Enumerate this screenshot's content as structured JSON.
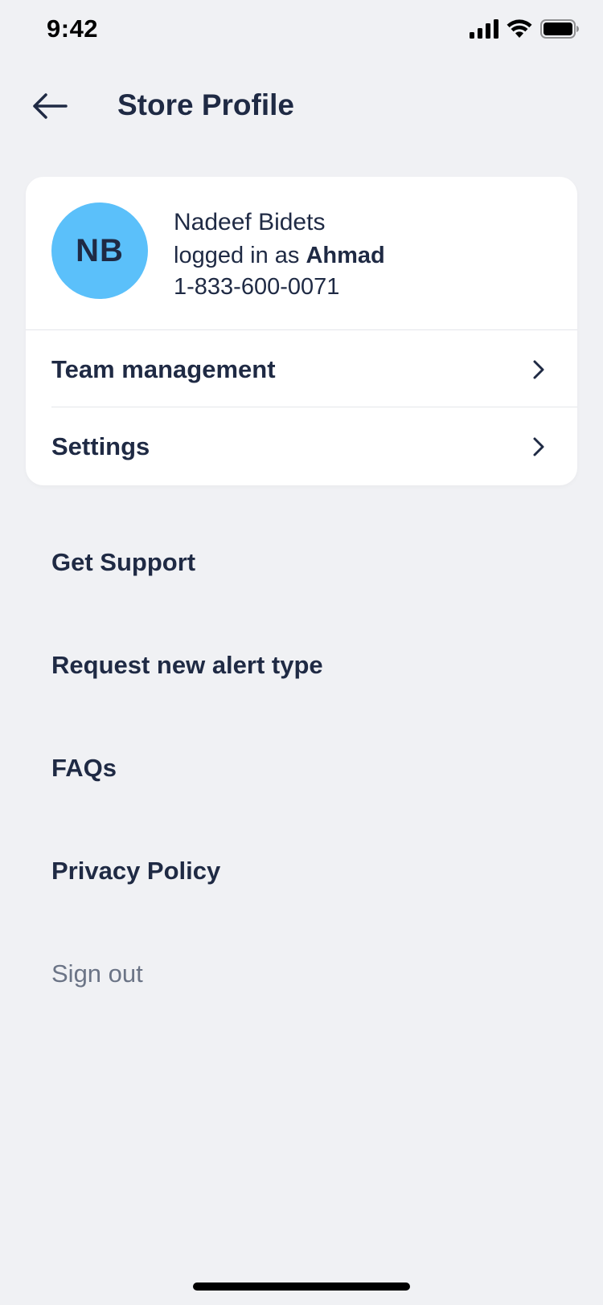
{
  "status_bar": {
    "time": "9:42",
    "icons": [
      "cellular-signal-icon",
      "wifi-icon",
      "battery-icon"
    ]
  },
  "header": {
    "back_icon": "arrow-left-icon",
    "title": "Store Profile"
  },
  "profile": {
    "initials": "NB",
    "avatar_color": "#5bc0fa",
    "store_name": "Nadeef Bidets",
    "logged_in_prefix": "logged in as",
    "user_name": "Ahmad",
    "phone": "1-833-600-0071"
  },
  "card_menu": [
    {
      "label": "Team management",
      "icon": "chevron-right-icon"
    },
    {
      "label": "Settings",
      "icon": "chevron-right-icon"
    }
  ],
  "menu": {
    "get_support": "Get Support",
    "request_alert": "Request new alert type",
    "faqs": "FAQs",
    "privacy_policy": "Privacy Policy",
    "sign_out": "Sign out"
  },
  "colors": {
    "background": "#f0f1f4",
    "text_primary": "#1f2a44",
    "text_muted": "#6b7486",
    "card": "#ffffff"
  }
}
